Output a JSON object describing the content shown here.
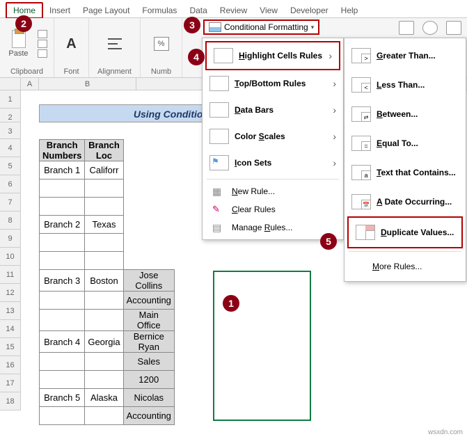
{
  "tabs": {
    "home": "Home",
    "insert": "Insert",
    "pageLayout": "Page Layout",
    "formulas": "Formulas",
    "data": "Data",
    "review": "Review",
    "view": "View",
    "developer": "Developer",
    "help": "Help"
  },
  "ribbon": {
    "paste": "Paste",
    "clipboard": "Clipboard",
    "font": "Font",
    "alignment": "Alignment",
    "number": "Numb",
    "conditionalFormatting": "Conditional Formatting"
  },
  "menu": {
    "highlight": "Highlight Cells Rules",
    "topBottom": "Top/Bottom Rules",
    "dataBars": "Data Bars",
    "colorScales": "Color Scales",
    "iconSets": "Icon Sets",
    "newRule": "New Rule...",
    "clearRules": "Clear Rules",
    "manageRules": "Manage Rules..."
  },
  "submenu": {
    "greater": "Greater Than...",
    "less": "Less Than...",
    "between": "Between...",
    "equal": "Equal To...",
    "textContains": "Text that Contains...",
    "dateOccurring": "A Date Occurring...",
    "duplicate": "Duplicate Values...",
    "moreRules": "More Rules..."
  },
  "sheet": {
    "title": "Using Conditional Formattin",
    "headers": {
      "c1": "Branch Numbers",
      "c2": "Branch Loc"
    },
    "rows": [
      {
        "b": "Branch 1",
        "l": "Califorr",
        "d": ""
      },
      {
        "b": "",
        "l": "",
        "d": ""
      },
      {
        "b": "",
        "l": "",
        "d": ""
      },
      {
        "b": "Branch 2",
        "l": "Texas",
        "d": ""
      },
      {
        "b": "",
        "l": "",
        "d": ""
      },
      {
        "b": "",
        "l": "",
        "d": ""
      },
      {
        "b": "Branch 3",
        "l": "Boston",
        "d": "Jose Collins"
      },
      {
        "b": "",
        "l": "",
        "d": "Accounting"
      },
      {
        "b": "",
        "l": "",
        "d": "Main Office"
      },
      {
        "b": "Branch 4",
        "l": "Georgia",
        "d": "Bernice Ryan"
      },
      {
        "b": "",
        "l": "",
        "d": "Sales"
      },
      {
        "b": "",
        "l": "",
        "d": "1200"
      },
      {
        "b": "Branch 5",
        "l": "Alaska",
        "d": "Nicolas"
      },
      {
        "b": "",
        "l": "",
        "d": "Accounting"
      }
    ],
    "rowLabels": [
      "1",
      "2",
      "3",
      "4",
      "5",
      "6",
      "7",
      "8",
      "9",
      "10",
      "11",
      "12",
      "13",
      "14",
      "15",
      "16",
      "17",
      "18"
    ],
    "colLabels": [
      "A",
      "B"
    ]
  },
  "badges": {
    "b1": "1",
    "b2": "2",
    "b3": "3",
    "b4": "4",
    "b5": "5"
  },
  "watermark": "wsxdn.com"
}
